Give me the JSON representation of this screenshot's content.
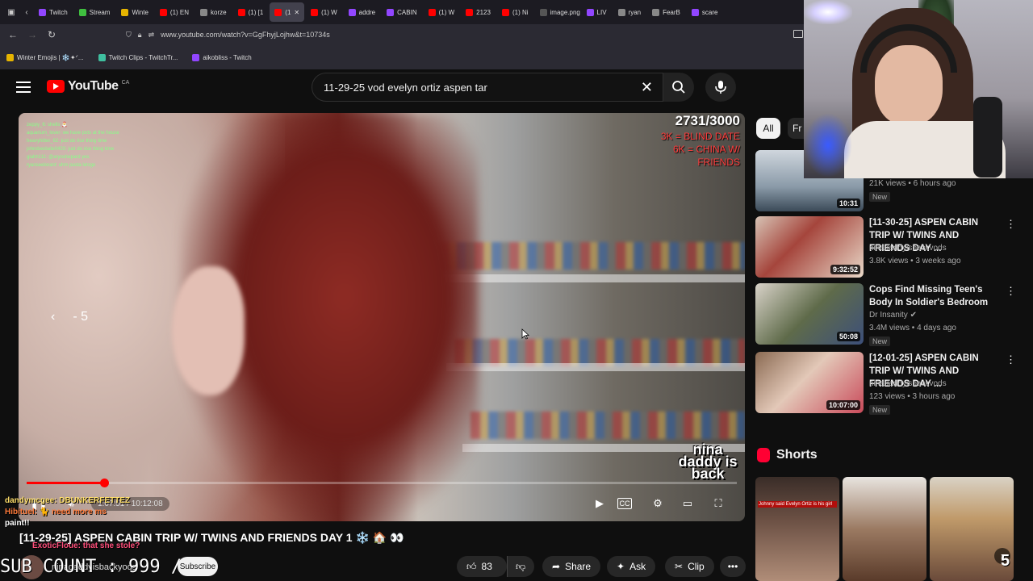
{
  "browser": {
    "tabs": [
      {
        "label": "Twitch",
        "color": "#9146ff"
      },
      {
        "label": "Stream",
        "color": "#3fbf3f"
      },
      {
        "label": "Winte",
        "color": "#e6b400"
      },
      {
        "label": "(1) EN",
        "color": "#ff0000"
      },
      {
        "label": "korze",
        "color": "#888888"
      },
      {
        "label": "(1) [1",
        "color": "#ff0000"
      },
      {
        "label": "(1",
        "color": "#ff0000",
        "active": true
      },
      {
        "label": "(1) W",
        "color": "#ff0000"
      },
      {
        "label": "addre",
        "color": "#9146ff"
      },
      {
        "label": "CABIN",
        "color": "#9146ff"
      },
      {
        "label": "(1) W",
        "color": "#ff0000"
      },
      {
        "label": "2123",
        "color": "#ff0000"
      },
      {
        "label": "(1) Ni",
        "color": "#ff0000"
      },
      {
        "label": "image.png",
        "color": "#555555"
      },
      {
        "label": "LIV",
        "color": "#9146ff"
      },
      {
        "label": "ryan",
        "color": "#888888"
      },
      {
        "label": "FearB",
        "color": "#888888"
      },
      {
        "label": "scare",
        "color": "#9146ff"
      }
    ],
    "url": "www.youtube.com/watch?v=GgFhyjLojhw&t=10734s",
    "bookmarks": [
      {
        "label": "Winter Emojis | ❄️✦ᐟ...",
        "color": "#e6b400"
      },
      {
        "label": "Twitch Clips - TwitchTr...",
        "color": "#3fbf9f"
      },
      {
        "label": "aikobliss - Twitch",
        "color": "#9146ff"
      }
    ]
  },
  "youtube": {
    "logo_text": "YouTube",
    "country_code": "CA",
    "search_query": "11-29-25 vod evelyn ortiz aspen tar"
  },
  "video": {
    "goal_count": "2731/3000",
    "goals": [
      "3K = BLIND DATE",
      "6K = CHINA W/",
      "FRIENDS"
    ],
    "chat_lines": [
      "zeppy_6: shells 🎅",
      "aquarium_lover: we have pots at the house",
      "heavyhitter_62: just do rice thing time",
      "johndoedude0420: just do rice thing time",
      "giahh111: @aryoshepard yes",
      "ryanseelorant: uhm pasta letsgo"
    ],
    "skip_label": "- 5",
    "stream_logo": "nina daddy is back",
    "time_display": "1:07:51 / 10:12:08",
    "progress": 0.109,
    "title": "[11-29-25] ASPEN CABIN TRIP W/ TWINS AND FRIENDS DAY 1 ❄️ 🏠 👀"
  },
  "overlay": {
    "lines": [
      "dandymcgee: DBUNKERFETTEZ",
      "Hibituel: 🐈 need more ms",
      "paint!!",
      "ExoticFloue: that she stole?"
    ]
  },
  "channel": {
    "name": "ninadaddyisbackyods",
    "subscribe_label": "Subscribe",
    "sub_count": "SUB COUNT : 999 /"
  },
  "actions": {
    "likes": "83",
    "share": "Share",
    "ask": "Ask",
    "clip": "Clip"
  },
  "sidebar": {
    "chip_all": "All",
    "chip_next": "Fr",
    "recommendations": [
      {
        "title": "",
        "channel": "",
        "meta": "21K views • 6 hours ago",
        "badge": "New",
        "duration": "10:31"
      },
      {
        "title": "[11-30-25] ASPEN CABIN TRIP W/ TWINS AND FRIENDS DAY ...",
        "channel": "ninadaddyisbackvods",
        "meta": "3.8K views • 3 weeks ago",
        "badge": "",
        "duration": "9:32:52"
      },
      {
        "title": "Cops Find Missing Teen's Body In Soldier's Bedroom",
        "channel": "Dr Insanity ✔",
        "meta": "3.4M views • 4 days ago",
        "badge": "New",
        "duration": "50:08"
      },
      {
        "title": "[12-01-25] ASPEN CABIN TRIP W/ TWINS AND FRIENDS DAY ...",
        "channel": "ninadaddyisbackvods",
        "meta": "123 views • 3 hours ago",
        "badge": "New",
        "duration": "10:07:00"
      }
    ],
    "shorts_title": "Shorts",
    "shorts_caption": "Johnny said Evelyn Ortiz is his girl"
  },
  "stream_number": "5"
}
